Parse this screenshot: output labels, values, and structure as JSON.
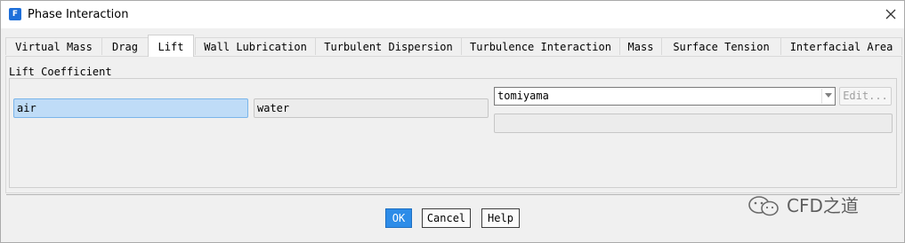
{
  "window": {
    "icon_letter": "F",
    "title": "Phase Interaction"
  },
  "tabs": [
    {
      "label": "Virtual Mass",
      "active": false
    },
    {
      "label": "Drag",
      "active": false
    },
    {
      "label": "Lift",
      "active": true
    },
    {
      "label": "Wall Lubrication",
      "active": false
    },
    {
      "label": "Turbulent Dispersion",
      "active": false
    },
    {
      "label": "Turbulence Interaction",
      "active": false
    },
    {
      "label": "Mass",
      "active": false
    },
    {
      "label": "Surface Tension",
      "active": false
    },
    {
      "label": "Interfacial Area",
      "active": false
    }
  ],
  "lift": {
    "group_label": "Lift Coefficient",
    "phase_a": "air",
    "phase_b": "water",
    "model_selected": "tomiyama",
    "edit_label": "Edit...",
    "parameter_value": ""
  },
  "footer": {
    "ok_label": "OK",
    "cancel_label": "Cancel",
    "help_label": "Help"
  },
  "watermark": {
    "text": "CFD之道",
    "icon": "wechat-icon"
  },
  "colors": {
    "accent": "#2d8ce8",
    "selected_field": "#bfdcf7",
    "app_icon": "#1e6fd9"
  }
}
